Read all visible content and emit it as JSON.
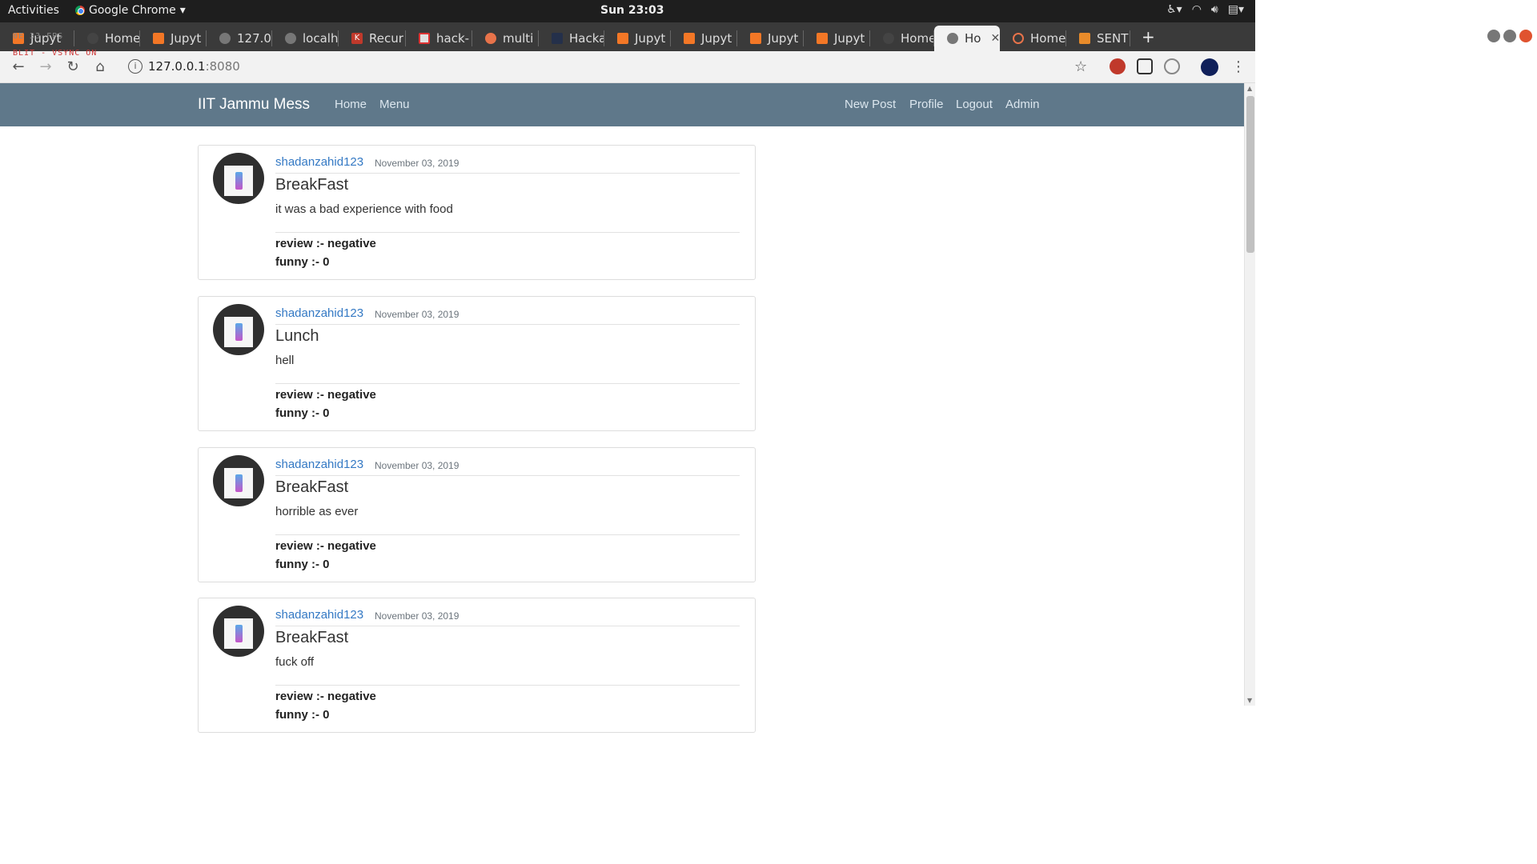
{
  "system_bar": {
    "activities": "Activities",
    "app_name": "Google Chrome",
    "clock": "Sun 23:03"
  },
  "overlay": {
    "line1": "BLIT - VSYNC ON"
  },
  "browser": {
    "tabs": [
      {
        "label": "Jupyt",
        "favicon": "jupyter-icon"
      },
      {
        "label": "Home",
        "favicon": "dark-circle-icon"
      },
      {
        "label": "Jupyt",
        "favicon": "jupyter-icon"
      },
      {
        "label": "127.0",
        "favicon": "globe-icon"
      },
      {
        "label": "localh",
        "favicon": "globe-icon"
      },
      {
        "label": "Recur",
        "favicon": "k-icon"
      },
      {
        "label": "hack-",
        "favicon": "mail-icon"
      },
      {
        "label": "multi",
        "favicon": "ask-icon"
      },
      {
        "label": "Hacka",
        "favicon": "h-icon"
      },
      {
        "label": "Jupyt",
        "favicon": "jupyter-icon"
      },
      {
        "label": "Jupyt",
        "favicon": "jupyter-icon"
      },
      {
        "label": "Jupyt",
        "favicon": "jupyter-icon"
      },
      {
        "label": "Jupyt",
        "favicon": "jupyter-icon"
      },
      {
        "label": "Home",
        "favicon": "dark-circle-icon"
      },
      {
        "label": "Ho",
        "favicon": "globe-icon",
        "active": true
      },
      {
        "label": "Home",
        "favicon": "ring-icon"
      },
      {
        "label": "SENT",
        "favicon": "sent-icon"
      }
    ],
    "url_host": "127.0.0.1",
    "url_port": ":8080"
  },
  "site": {
    "brand": "IIT Jammu Mess",
    "nav_left": [
      "Home",
      "Menu"
    ],
    "nav_right": [
      "New Post",
      "Profile",
      "Logout",
      "Admin"
    ]
  },
  "posts": [
    {
      "author": "shadanzahid123",
      "date": "November 03, 2019",
      "title": "BreakFast",
      "body": "it was a bad experience with food",
      "review": "review :- negative",
      "funny": "funny :- 0"
    },
    {
      "author": "shadanzahid123",
      "date": "November 03, 2019",
      "title": "Lunch",
      "body": "hell",
      "review": "review :- negative",
      "funny": "funny :- 0"
    },
    {
      "author": "shadanzahid123",
      "date": "November 03, 2019",
      "title": "BreakFast",
      "body": "horrible as ever",
      "review": "review :- negative",
      "funny": "funny :- 0"
    },
    {
      "author": "shadanzahid123",
      "date": "November 03, 2019",
      "title": "BreakFast",
      "body": "fuck off",
      "review": "review :- negative",
      "funny": "funny :- 0"
    }
  ],
  "colors": {
    "navbar_bg": "#5f788a",
    "link": "#3479c4"
  }
}
